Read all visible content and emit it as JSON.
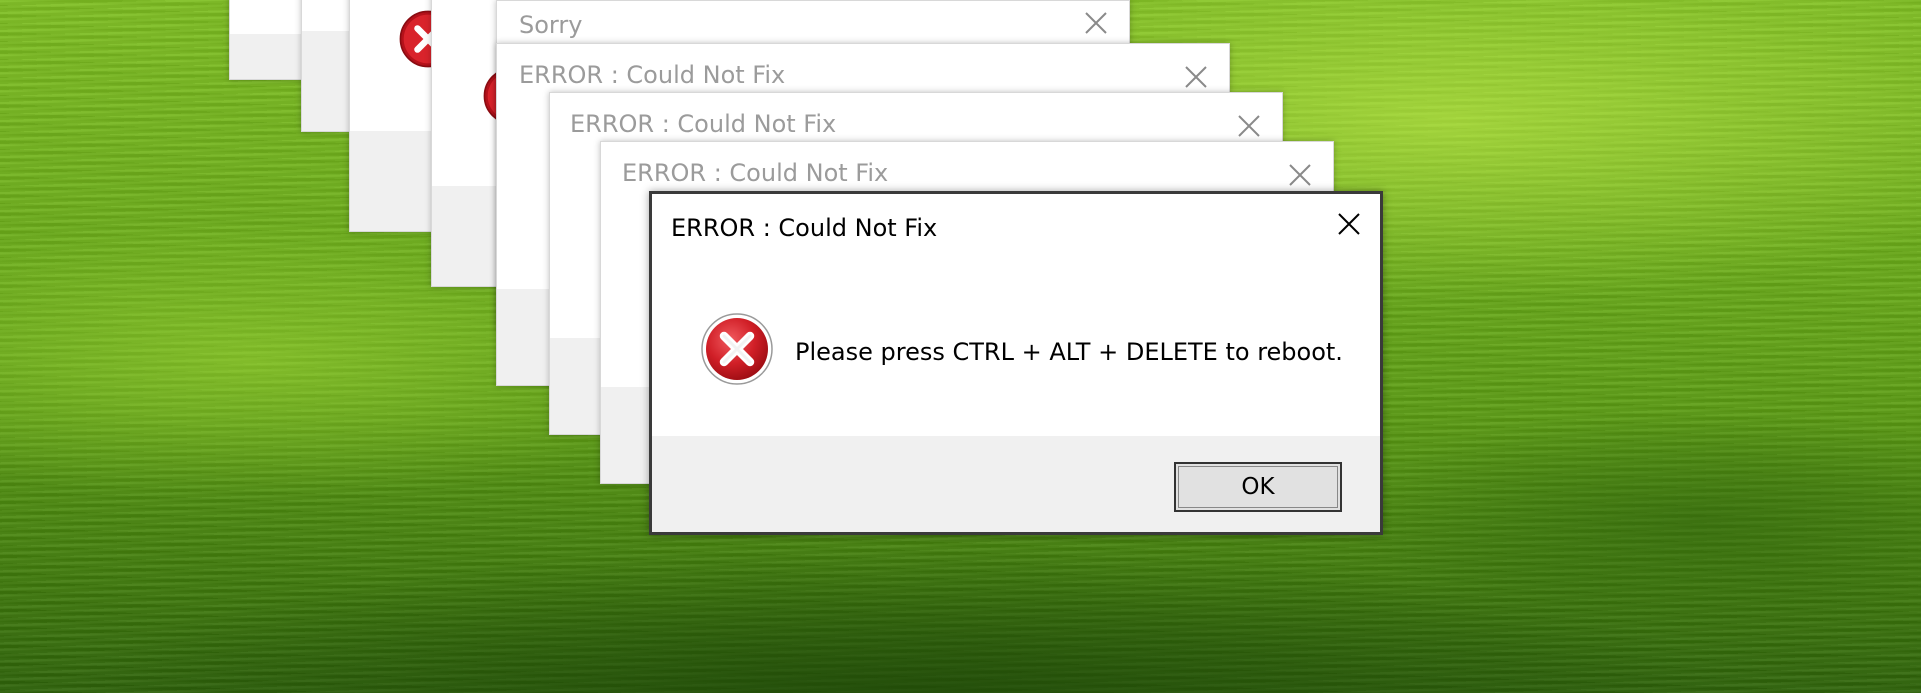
{
  "desktop": {
    "wallpaper": "green grass field"
  },
  "dialogs_behind": [
    {
      "title": ""
    },
    {
      "title": ""
    },
    {
      "title": ""
    },
    {
      "title": ""
    },
    {
      "title": "Sorry"
    },
    {
      "title": "ERROR : Could Not Fix"
    },
    {
      "title": "ERROR : Could Not Fix"
    },
    {
      "title": "ERROR : Could Not Fix"
    }
  ],
  "front_dialog": {
    "title": "ERROR : Could Not Fix",
    "message": "Please press CTRL + ALT + DELETE to reboot.",
    "ok_label": "OK",
    "icon": "error-icon",
    "close_icon": "close-icon"
  },
  "colors": {
    "error_red": "#c8141c",
    "title_inactive": "#9b9b9b",
    "footer": "#f0f0f0"
  }
}
